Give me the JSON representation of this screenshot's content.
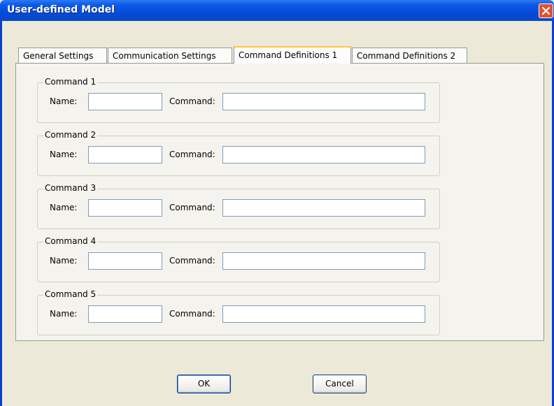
{
  "window": {
    "title": "User-defined Model"
  },
  "tabs": [
    {
      "label": "General Settings",
      "active": false
    },
    {
      "label": "Communication Settings",
      "active": false
    },
    {
      "label": "Command Definitions 1",
      "active": true
    },
    {
      "label": "Command Definitions 2",
      "active": false
    }
  ],
  "commands": [
    {
      "legend": "Command 1",
      "name_label": "Name:",
      "command_label": "Command:",
      "name_value": "",
      "command_value": ""
    },
    {
      "legend": "Command 2",
      "name_label": "Name:",
      "command_label": "Command:",
      "name_value": "",
      "command_value": ""
    },
    {
      "legend": "Command 3",
      "name_label": "Name:",
      "command_label": "Command:",
      "name_value": "",
      "command_value": ""
    },
    {
      "legend": "Command 4",
      "name_label": "Name:",
      "command_label": "Command:",
      "name_value": "",
      "command_value": ""
    },
    {
      "legend": "Command 5",
      "name_label": "Name:",
      "command_label": "Command:",
      "name_value": "",
      "command_value": ""
    }
  ],
  "buttons": {
    "ok": "OK",
    "cancel": "Cancel"
  },
  "colors": {
    "titlebar": "#0a58e8",
    "close": "#e1512f",
    "active_tab_highlight": "#ffc83c"
  }
}
